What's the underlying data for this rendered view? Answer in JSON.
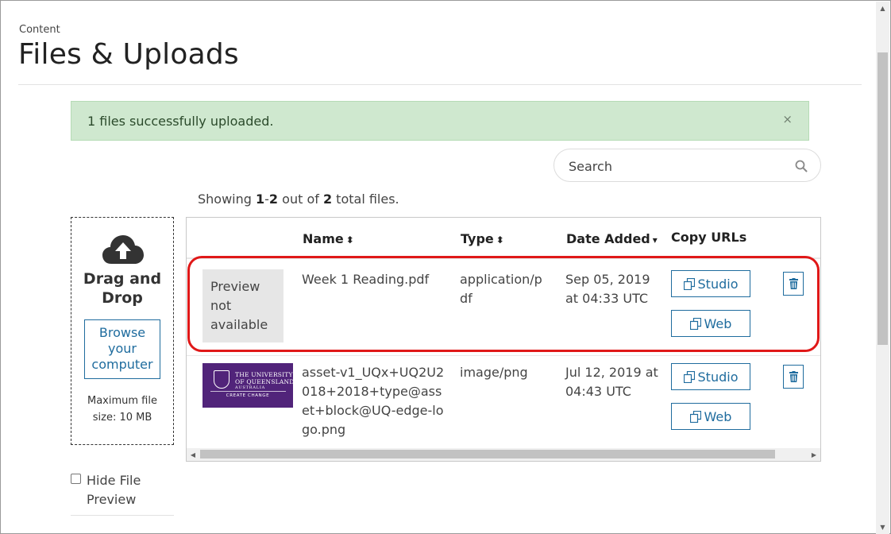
{
  "breadcrumb": "Content",
  "title": "Files & Uploads",
  "alert": {
    "message": "1 files successfully uploaded.",
    "close": "×"
  },
  "search": {
    "placeholder": "Search"
  },
  "showing": {
    "prefix": "Showing ",
    "range_start": "1",
    "range_sep": "-",
    "range_end": "2",
    "middle": " out of ",
    "total": "2",
    "suffix": " total files."
  },
  "dropzone": {
    "title": "Drag and Drop",
    "browse_label": "Browse your computer",
    "max_size": "Maximum file size: 10 MB"
  },
  "hide_preview": {
    "label": "Hide File Preview",
    "checked": false
  },
  "table": {
    "columns": {
      "name": "Name",
      "type": "Type",
      "date": "Date Added",
      "copy": "Copy URLs"
    },
    "rows": [
      {
        "preview": "Preview not available",
        "name": "Week 1 Reading.pdf",
        "type": "application/pdf",
        "date": "Sep 05, 2019 at 04:33 UTC",
        "studio": "Studio",
        "web": "Web"
      },
      {
        "preview_image": {
          "line1": "THE UNIVERSITY",
          "line2": "OF QUEENSLAND",
          "line3": "AUSTRALIA",
          "tagline": "CREATE CHANGE"
        },
        "name": "asset-v1_UQx+UQ2U2018+2018+type@asset+block@UQ-edge-logo.png",
        "type": "image/png",
        "date": "Jul 12, 2019 at 04:43 UTC",
        "studio": "Studio",
        "web": "Web"
      }
    ]
  },
  "icons": {
    "upload": "cloud-upload-icon",
    "search": "search-icon",
    "copy": "copy-icon",
    "delete": "trash-icon",
    "sort": "sort-icon",
    "sort_desc": "caret-down-icon"
  },
  "colors": {
    "accent": "#1f6c9e",
    "alert_bg": "#cfe8cf",
    "highlight": "#e01818",
    "brand_purple": "#51247a"
  }
}
